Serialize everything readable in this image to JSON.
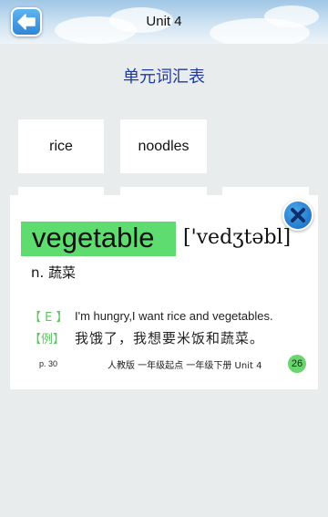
{
  "header": {
    "title": "Unit 4",
    "back_icon": "back-arrow-icon",
    "colors": {
      "button": "#2f86d6",
      "sky": "#9fc6e6"
    }
  },
  "subtitle": "单元词汇表",
  "words": [
    "rice",
    "noodles"
  ],
  "popup": {
    "headword": "vegetable",
    "phonetic": "['vedʒtəbl]",
    "pos_meaning": "n.  蔬菜",
    "example_en_tag": "【 E 】",
    "example_en": "I'm hungry,I want rice and vegetables.",
    "example_cn_tag": "【例】",
    "example_cn": "我饿了，我想要米饭和蔬菜。",
    "page": "p. 30",
    "source": "人教版  一年级起点  一年级下册  Unit 4",
    "count": "26",
    "close_icon": "close-icon",
    "colors": {
      "highlight": "#5fdc70",
      "tag": "#58c95e",
      "badge": "#6ad56e"
    }
  }
}
